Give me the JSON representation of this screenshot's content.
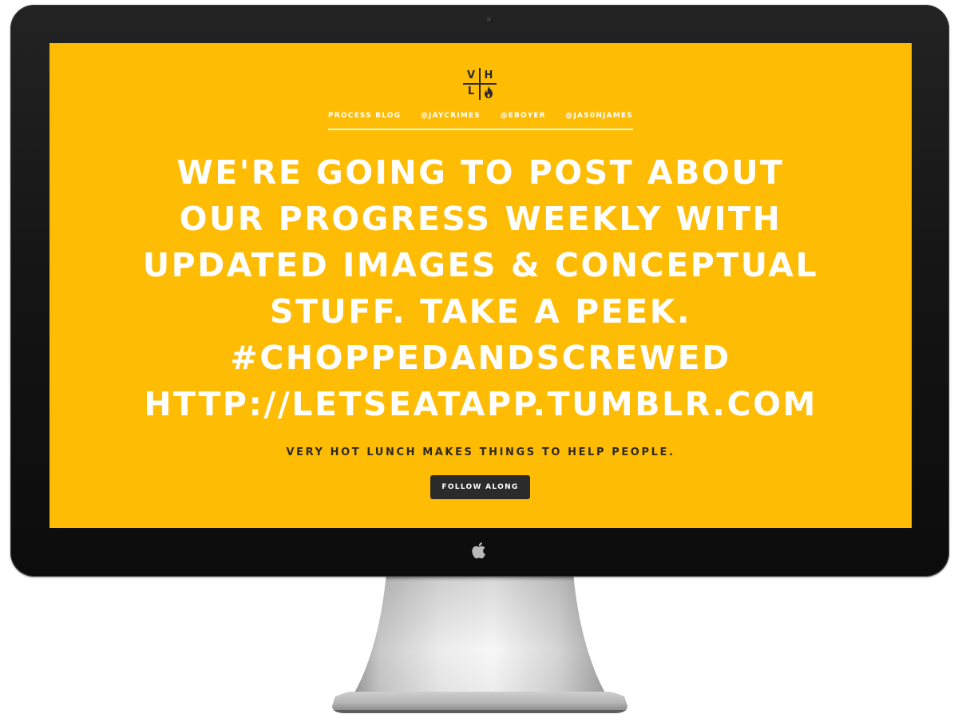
{
  "logo": {
    "letters": [
      "V",
      "H",
      "L"
    ]
  },
  "nav": {
    "items": [
      {
        "label": "PROCESS BLOG"
      },
      {
        "label": "@JAYCRIMES"
      },
      {
        "label": "@EBOYER"
      },
      {
        "label": "@JAS0NJAMES"
      }
    ]
  },
  "headline": {
    "lines": [
      "WE'RE GOING TO POST ABOUT",
      "OUR PROGRESS WEEKLY WITH",
      "UPDATED IMAGES & CONCEPTUAL",
      "STUFF. TAKE A PEEK.",
      "#CHOPPEDANDSCREWED",
      "HTTP://LETSEATAPP.TUMBLR.COM"
    ]
  },
  "tagline": "VERY HOT LUNCH MAKES THINGS TO HELP PEOPLE.",
  "cta": {
    "label": "FOLLOW ALONG"
  },
  "colors": {
    "screen_background": "#ffbc04",
    "headline_text": "#ffffff",
    "tagline_text": "#2f2a1f",
    "button_background": "#2b2b2b",
    "bezel": "#141414"
  },
  "icons": {
    "logo_flame": "flame-icon",
    "hardware_logo": "apple-icon",
    "camera": "camera-icon"
  }
}
